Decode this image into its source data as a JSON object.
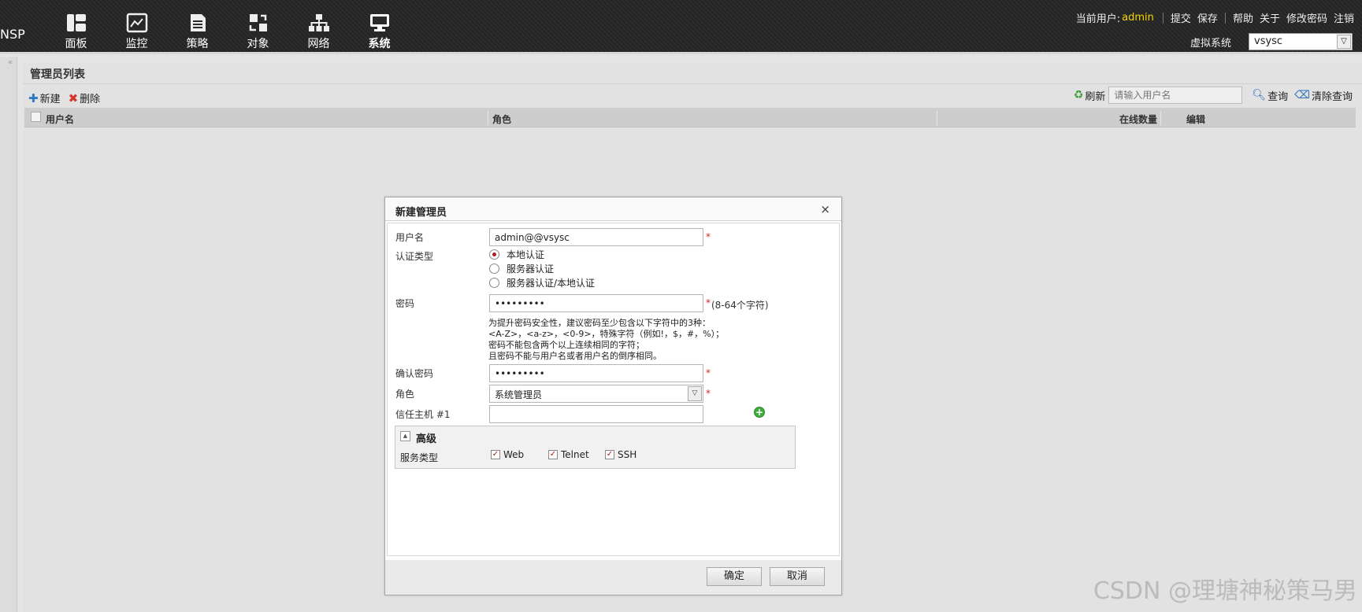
{
  "brand": "NSP",
  "nav": [
    {
      "label": "面板",
      "icon": "dashboard-icon"
    },
    {
      "label": "监控",
      "icon": "monitor-icon"
    },
    {
      "label": "策略",
      "icon": "policy-icon"
    },
    {
      "label": "对象",
      "icon": "object-icon"
    },
    {
      "label": "网络",
      "icon": "network-icon"
    },
    {
      "label": "系统",
      "icon": "system-icon",
      "active": true
    }
  ],
  "topbar": {
    "current_user_label": "当前用户:",
    "current_user": "admin",
    "links": [
      "提交",
      "保存",
      "帮助",
      "关于",
      "修改密码",
      "注销"
    ],
    "vsys_label": "虚拟系统",
    "vsys_value": "vsysc"
  },
  "panel": {
    "title": "管理员列表",
    "new_label": "新建",
    "delete_label": "删除",
    "refresh_label": "刷新",
    "search_placeholder": "请输入用户名",
    "query_label": "查询",
    "clear_query_label": "清除查询",
    "columns": [
      "用户名",
      "角色",
      "在线数量",
      "编辑"
    ]
  },
  "dialog": {
    "title": "新建管理员",
    "close": "×",
    "username_label": "用户名",
    "username_value": "admin@@vsysc",
    "auth_type_label": "认证类型",
    "auth_options": [
      "本地认证",
      "服务器认证",
      "服务器认证/本地认证"
    ],
    "auth_selected": 0,
    "password_label": "密码",
    "password_value": "•••••••••",
    "password_note": "(8-64个字符)",
    "password_hints": [
      "为提升密码安全性，建议密码至少包含以下字符中的3种：",
      "<A-Z>，<a-z>，<0-9>，特殊字符（例如!，$，#，%）；",
      "密码不能包含两个以上连续相同的字符；",
      "且密码不能与用户名或者用户名的倒序相同。"
    ],
    "confirm_label": "确认密码",
    "confirm_value": "•••••••••",
    "role_label": "角色",
    "role_value": "系统管理员",
    "trusted_host_label": "信任主机 #1",
    "trusted_host_value": "",
    "advanced_title": "高级",
    "service_type_label": "服务类型",
    "services": [
      {
        "label": "Web",
        "checked": true
      },
      {
        "label": "Telnet",
        "checked": true
      },
      {
        "label": "SSH",
        "checked": true
      }
    ],
    "ok_label": "确定",
    "cancel_label": "取消",
    "required_mark": "*"
  },
  "watermark": "CSDN @理塘神秘策马男",
  "colors": {
    "accent_user": "#f5d400",
    "required": "#dd2222",
    "topbar": "#2a2a2a"
  }
}
